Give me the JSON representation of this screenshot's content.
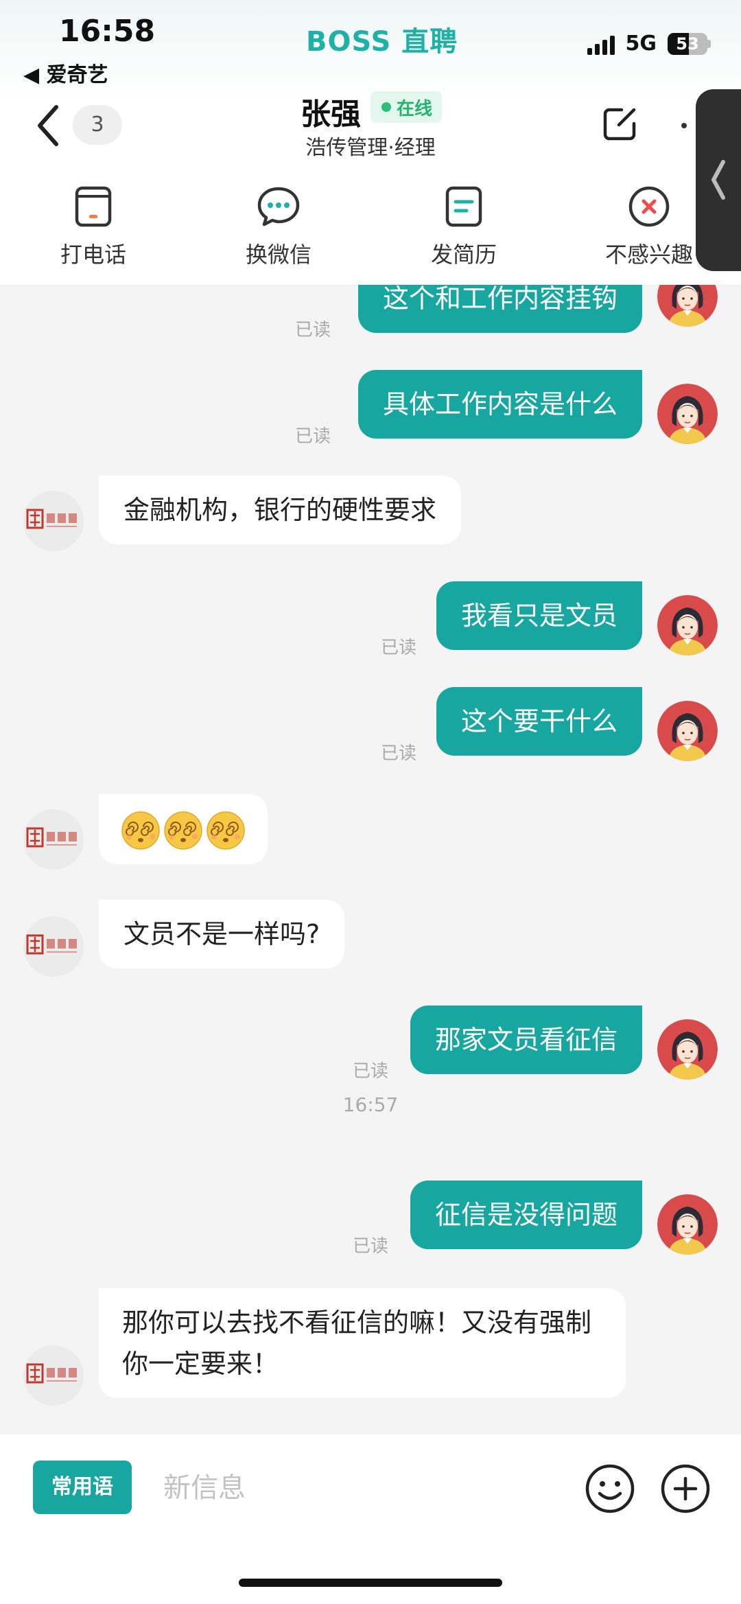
{
  "status_bar": {
    "time": "16:58",
    "back_app": "◀ 爱奇艺",
    "brand": "BOSS 直聘",
    "network": "5G",
    "battery": "53",
    "battery_level": 0.53
  },
  "header": {
    "unread_count": "3",
    "contact_name": "张强",
    "online_label": "在线",
    "subtitle": "浩传管理·经理"
  },
  "actions": [
    {
      "label": "打电话",
      "icon": "phone-icon"
    },
    {
      "label": "换微信",
      "icon": "wechat-icon"
    },
    {
      "label": "发简历",
      "icon": "resume-icon"
    },
    {
      "label": "不感兴趣",
      "icon": "not-interested-icon"
    }
  ],
  "messages": [
    {
      "side": "out",
      "text": "这个和工作内容挂钩",
      "read": "已读"
    },
    {
      "side": "out",
      "text": "具体工作内容是什么",
      "read": "已读"
    },
    {
      "side": "in",
      "text": "金融机构，银行的硬性要求"
    },
    {
      "side": "out",
      "text": "我看只是文员",
      "read": "已读"
    },
    {
      "side": "out",
      "text": "这个要干什么",
      "read": "已读"
    },
    {
      "side": "in",
      "emoji": "dizzy-face-icon",
      "emoji_count": 3
    },
    {
      "side": "in",
      "text": "文员不是一样吗?"
    },
    {
      "side": "out",
      "text": "那家文员看征信",
      "read": "已读"
    },
    {
      "side": "out",
      "text": "征信是没得问题",
      "read": "已读"
    },
    {
      "side": "in",
      "text": "那你可以去找不看征信的嘛！又没有强制你一定要来！"
    }
  ],
  "timestamp": "16:57",
  "avatar_left_text": "浩传企业",
  "input": {
    "quick_phrase_label": "常用语",
    "placeholder": "新信息"
  },
  "colors": {
    "accent": "#18a6a0",
    "brand": "#1fb0a8",
    "online": "#2bbf79"
  }
}
